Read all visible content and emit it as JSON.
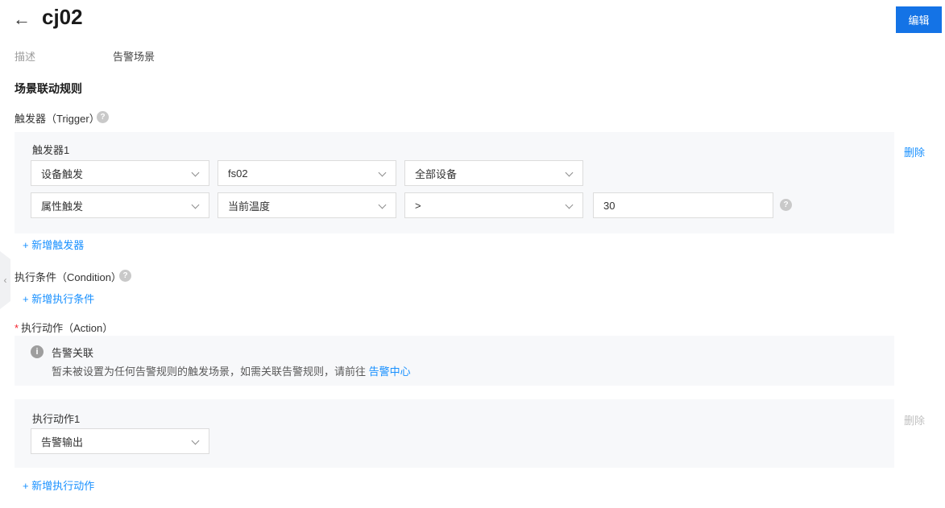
{
  "header": {
    "title": "cj02",
    "edit_button": "编辑"
  },
  "icons": {
    "back": "←",
    "help": "?",
    "info": "i",
    "collapse": "‹"
  },
  "meta": {
    "desc_label": "描述",
    "desc_value": "告警场景"
  },
  "section_title": "场景联动规则",
  "trigger": {
    "label": "触发器（Trigger）",
    "card_title": "触发器1",
    "delete_label": "删除",
    "row1": [
      "设备触发",
      "fs02",
      "全部设备"
    ],
    "row2": [
      "属性触发",
      "当前温度",
      ">"
    ],
    "value_input": "30",
    "add_label": "+ 新增触发器"
  },
  "condition": {
    "label": "执行条件（Condition）",
    "add_label": "+ 新增执行条件"
  },
  "action": {
    "required_mark": "*",
    "label": "执行动作（Action）",
    "notice": {
      "title": "告警关联",
      "text": "暂未被设置为任何告警规则的触发场景，如需关联告警规则，请前往 ",
      "link": "告警中心"
    },
    "card_title": "执行动作1",
    "delete_label": "删除",
    "select_value": "告警输出",
    "add_label": "+ 新增执行动作"
  },
  "colors": {
    "accent_button": "#1473e6",
    "link_blue": "#1890ff",
    "panel_bg": "#f7f8fa",
    "required_red": "#f5222d"
  }
}
